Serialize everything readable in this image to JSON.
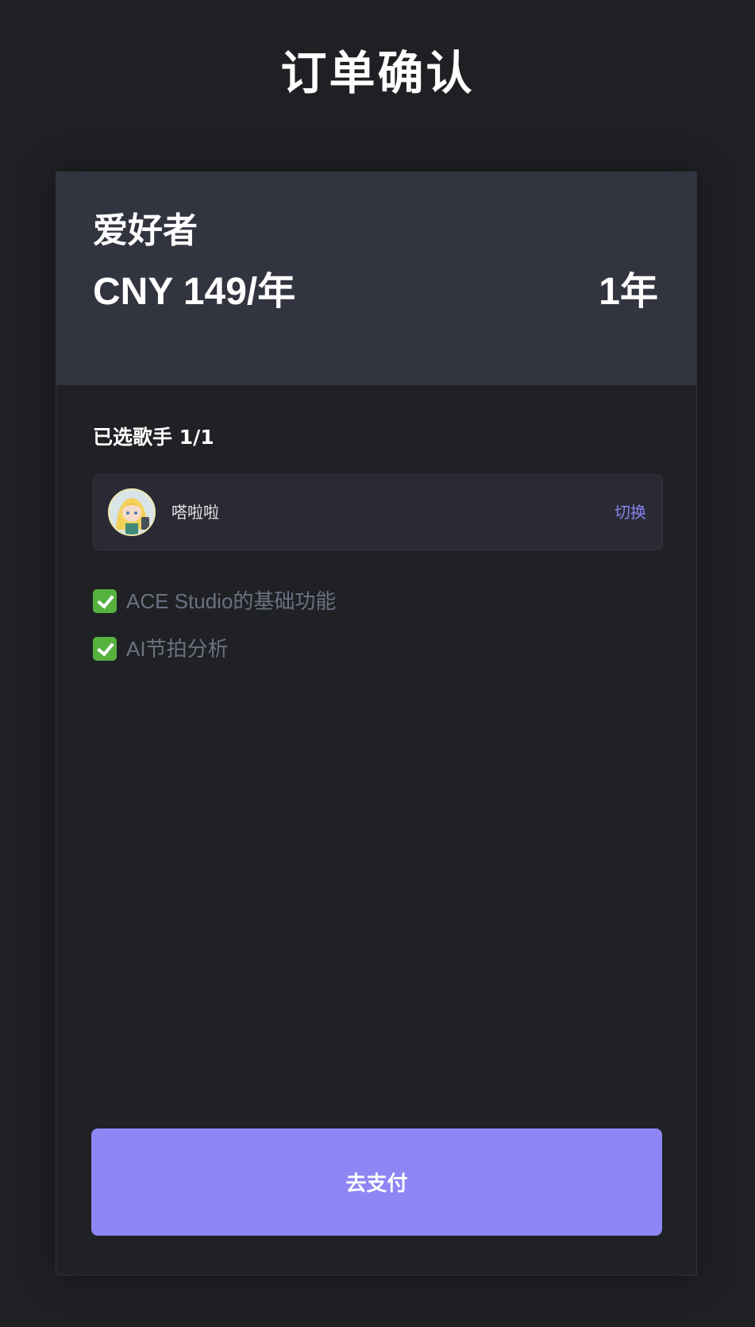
{
  "page": {
    "title": "订单确认"
  },
  "plan": {
    "name": "爱好者",
    "price": "CNY 149/年",
    "duration": "1年"
  },
  "singers": {
    "label": "已选歌手 1/1",
    "selected": {
      "name": "嗒啦啦",
      "avatar": "singer-avatar"
    },
    "switch_label": "切换"
  },
  "features": [
    {
      "icon": "check-mark-icon",
      "text": "ACE Studio的基础功能"
    },
    {
      "icon": "check-mark-icon",
      "text": "AI节拍分析"
    }
  ],
  "actions": {
    "pay_label": "去支付"
  },
  "colors": {
    "background": "#1f2024",
    "header": "#32343f",
    "accent": "#8e86f4",
    "link": "#8b82f0",
    "check": "#55b23f",
    "muted_text": "#6d7080"
  }
}
